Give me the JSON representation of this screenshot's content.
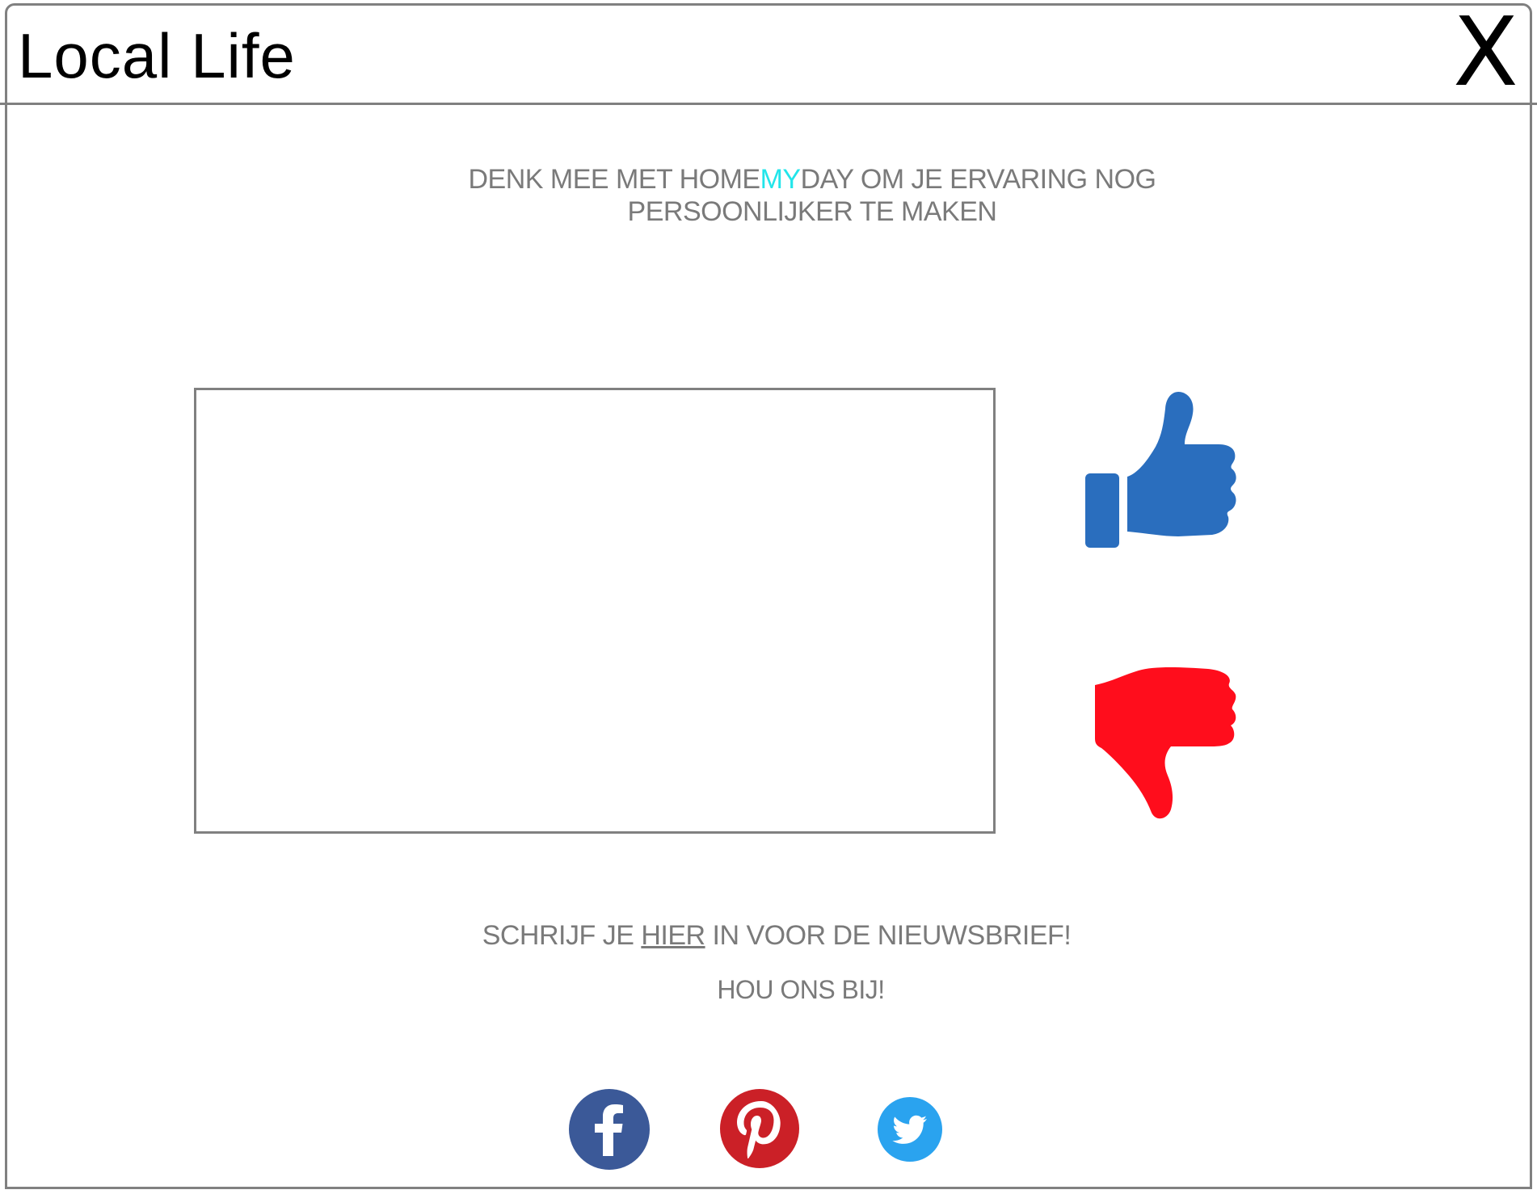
{
  "header": {
    "title": "Local Life",
    "close_label": "X"
  },
  "headline": {
    "part1": "DENK MEE MET HOME",
    "accent": "MY",
    "part2": "DAY OM JE ERVARING NOG PERSOONLIJKER TE MAKEN",
    "accent_color": "#22e5ea"
  },
  "vote": {
    "like_icon": "thumbs-up-icon",
    "like_color": "#2a6ebe",
    "dislike_icon": "thumbs-down-icon",
    "dislike_color": "#ff0d1c"
  },
  "newsletter": {
    "prefix": "SCHRIJF JE ",
    "link": "HIER",
    "suffix": " IN VOOR DE NIEUWSBRIEF!"
  },
  "follow": {
    "text": "HOU ONS BIJ!"
  },
  "social": [
    {
      "name": "facebook",
      "icon": "facebook-icon",
      "color": "#3b5998"
    },
    {
      "name": "pinterest",
      "icon": "pinterest-icon",
      "color": "#cb2027"
    },
    {
      "name": "twitter",
      "icon": "twitter-icon",
      "color": "#2aa3ef"
    }
  ]
}
